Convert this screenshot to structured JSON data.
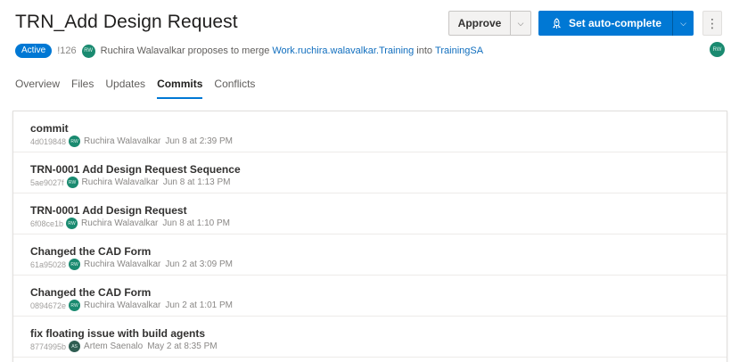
{
  "header": {
    "title": "TRN_Add Design Request",
    "approve_label": "Approve",
    "autocomplete_label": "Set auto-complete",
    "more_label": "⋮"
  },
  "pr": {
    "status": "Active",
    "id": "!126",
    "author": "Ruchira Walavalkar",
    "author_initials": "RW",
    "proposes_text": "proposes to merge",
    "source_branch": "Work.ruchira.walavalkar.Training",
    "into_text": "into",
    "target_branch": "TrainingSA",
    "reviewer_initials": "RW"
  },
  "tabs": [
    {
      "label": "Overview"
    },
    {
      "label": "Files"
    },
    {
      "label": "Updates"
    },
    {
      "label": "Commits",
      "active": true
    },
    {
      "label": "Conflicts"
    }
  ],
  "commits": [
    {
      "message": "commit",
      "hash": "4d019848",
      "initials": "RW",
      "author": "Ruchira Walavalkar",
      "date": "Jun 8 at 2:39 PM"
    },
    {
      "message": "TRN-0001 Add Design Request Sequence",
      "hash": "5ae9027f",
      "initials": "RW",
      "author": "Ruchira Walavalkar",
      "date": "Jun 8 at 1:13 PM"
    },
    {
      "message": "TRN-0001 Add Design Request",
      "hash": "6f08ce1b",
      "initials": "RW",
      "author": "Ruchira Walavalkar",
      "date": "Jun 8 at 1:10 PM"
    },
    {
      "message": "Changed the CAD Form",
      "hash": "61a95028",
      "initials": "RW",
      "author": "Ruchira Walavalkar",
      "date": "Jun 2 at 3:09 PM"
    },
    {
      "message": "Changed the CAD Form",
      "hash": "0894672e",
      "initials": "RW",
      "author": "Ruchira Walavalkar",
      "date": "Jun 2 at 1:01 PM"
    },
    {
      "message": "fix floating issue with build agents",
      "hash": "8774995b",
      "initials": "AS",
      "author": "Artem Saenalo",
      "date": "May 2 at 8:35 PM"
    }
  ],
  "colors": {
    "accent": "#0078d4",
    "avatar": "#1a8a70",
    "avatar_alt": "#2f5d52"
  },
  "icons": {
    "autocomplete": "rocket-icon",
    "dropdown": "chevron-down-icon",
    "more": "more-vertical-icon"
  }
}
